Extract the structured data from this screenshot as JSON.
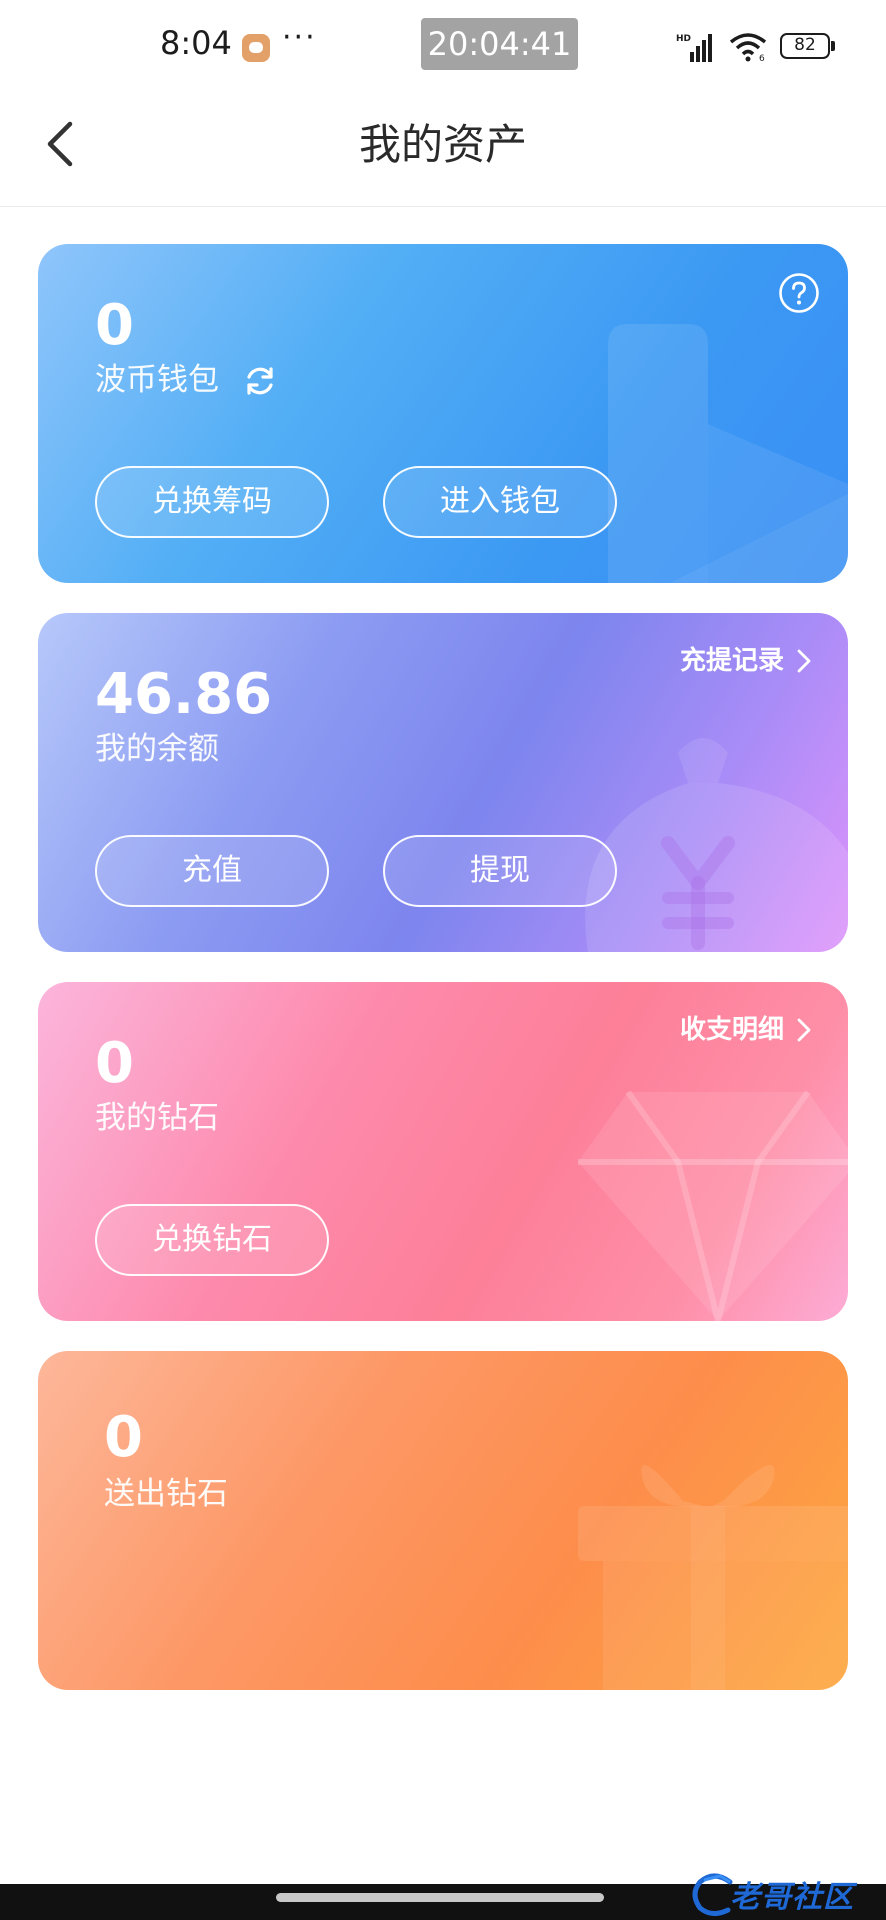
{
  "status_bar": {
    "time": "8:04",
    "dots": "···",
    "clock_overlay": "20:04:41",
    "battery": "82",
    "network_label": "HD"
  },
  "header": {
    "title": "我的资产"
  },
  "cards": {
    "wallet": {
      "value": "0",
      "label": "波币钱包",
      "button_left": "兑换筹码",
      "button_right": "进入钱包"
    },
    "balance": {
      "value": "46.86",
      "label": "我的余额",
      "link": "充提记录",
      "button_left": "充值",
      "button_right": "提现"
    },
    "diamond": {
      "value": "0",
      "label": "我的钻石",
      "link": "收支明细",
      "button_left": "兑换钻石"
    },
    "sent": {
      "value": "0",
      "label": "送出钻石"
    }
  },
  "footer": {
    "logo_text": "老哥社区"
  },
  "icons": {
    "back": "chevron-left-icon",
    "refresh": "refresh-icon",
    "help": "question-circle-icon",
    "link_arrow": "chevron-right-icon"
  }
}
